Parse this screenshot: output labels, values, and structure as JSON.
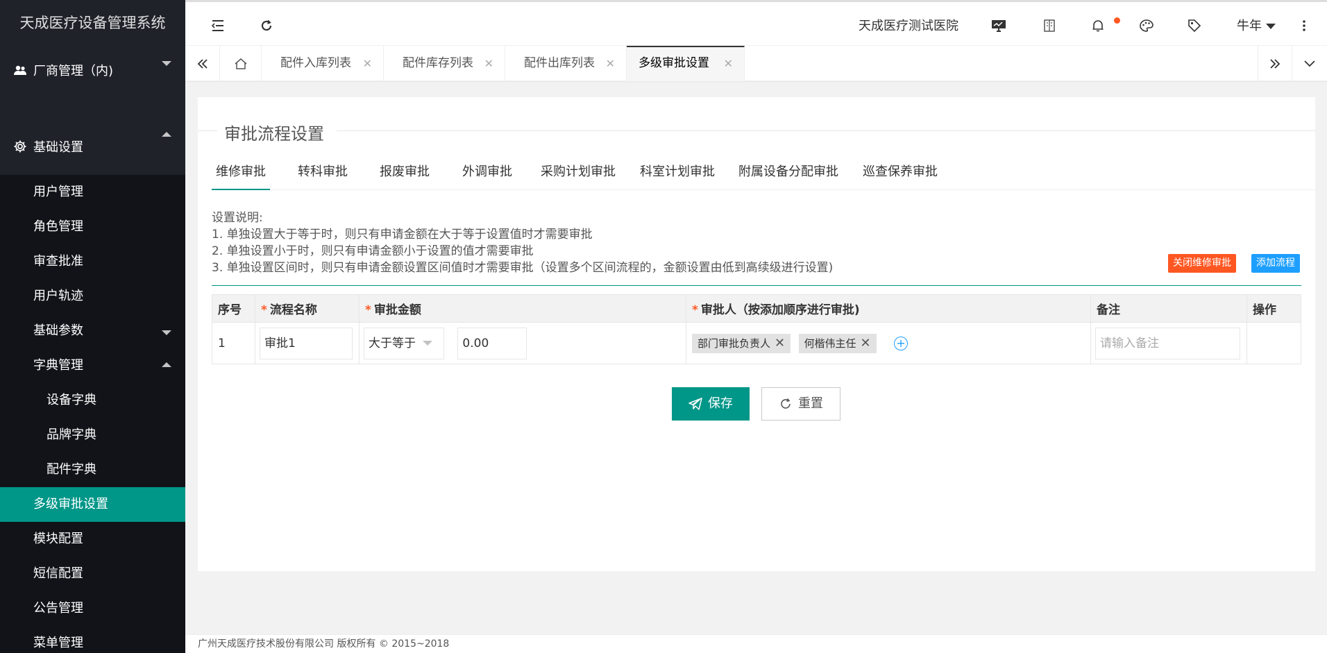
{
  "app": {
    "title": "天成医疗设备管理系统"
  },
  "sidebar": {
    "groups": [
      {
        "label": "厂商管理（内)",
        "icon": "users-icon",
        "expanded": false
      },
      {
        "label": "基础设置",
        "icon": "gear-icon",
        "expanded": true
      }
    ],
    "items": [
      {
        "label": "用户管理"
      },
      {
        "label": "角色管理"
      },
      {
        "label": "审查批准"
      },
      {
        "label": "用户轨迹"
      },
      {
        "label": "基础参数"
      },
      {
        "label": "字典管理"
      },
      {
        "label": "多级审批设置"
      },
      {
        "label": "模块配置"
      },
      {
        "label": "短信配置"
      },
      {
        "label": "公告管理"
      },
      {
        "label": "菜单管理"
      }
    ],
    "dict_items": [
      {
        "label": "设备字典"
      },
      {
        "label": "品牌字典"
      },
      {
        "label": "配件字典"
      }
    ]
  },
  "header": {
    "hospital": "天成医疗测试医院",
    "user": "牛年",
    "icons": [
      "menu-collapse-icon",
      "refresh-icon",
      "monitor-icon",
      "book-icon",
      "bell-icon",
      "palette-icon",
      "tag-icon",
      "more-vertical-icon"
    ],
    "notify_color": "#ff5722"
  },
  "tabs": [
    {
      "label": "配件入库列表"
    },
    {
      "label": "配件库存列表"
    },
    {
      "label": "配件出库列表"
    },
    {
      "label": "多级审批设置",
      "active": true
    }
  ],
  "page": {
    "legend": "审批流程设置",
    "inner_tabs": [
      "维修审批",
      "转科审批",
      "报废审批",
      "外调审批",
      "采购计划审批",
      "科室计划审批",
      "附属设备分配审批",
      "巡查保养审批"
    ],
    "desc": {
      "title": "设置说明:",
      "lines": [
        "1. 单独设置大于等于时，则只有申请金额在大于等于设置值时才需要审批",
        "2. 单独设置小于时，则只有申请金额小于设置的值才需要审批",
        "3. 单独设置区间时，则只有申请金额设置区间值时才需要审批（设置多个区间流程的，金额设置由低到高续级进行设置)"
      ]
    },
    "close_btn": "关闭维修审批",
    "add_btn": "添加流程",
    "table": {
      "headers": {
        "no": "序号",
        "name": "流程名称",
        "amount": "审批金额",
        "approver": "审批人（按添加顺序进行审批)",
        "remark": "备注",
        "op": "操作"
      },
      "required_mark": "*",
      "rows": [
        {
          "no": "1",
          "name": "审批1",
          "compare": "大于等于",
          "amount": "0.00",
          "approvers": [
            "部门审批负责人",
            "何楷伟主任"
          ],
          "remark_placeholder": "请输入备注"
        }
      ]
    },
    "save": "保存",
    "reset": "重置"
  },
  "footer": "广州天成医疗技术股份有限公司 版权所有 © 2015~2018",
  "colors": {
    "accent": "#009688",
    "danger": "#ff5722",
    "info": "#1e9fff",
    "sidebar": "#20222a"
  }
}
